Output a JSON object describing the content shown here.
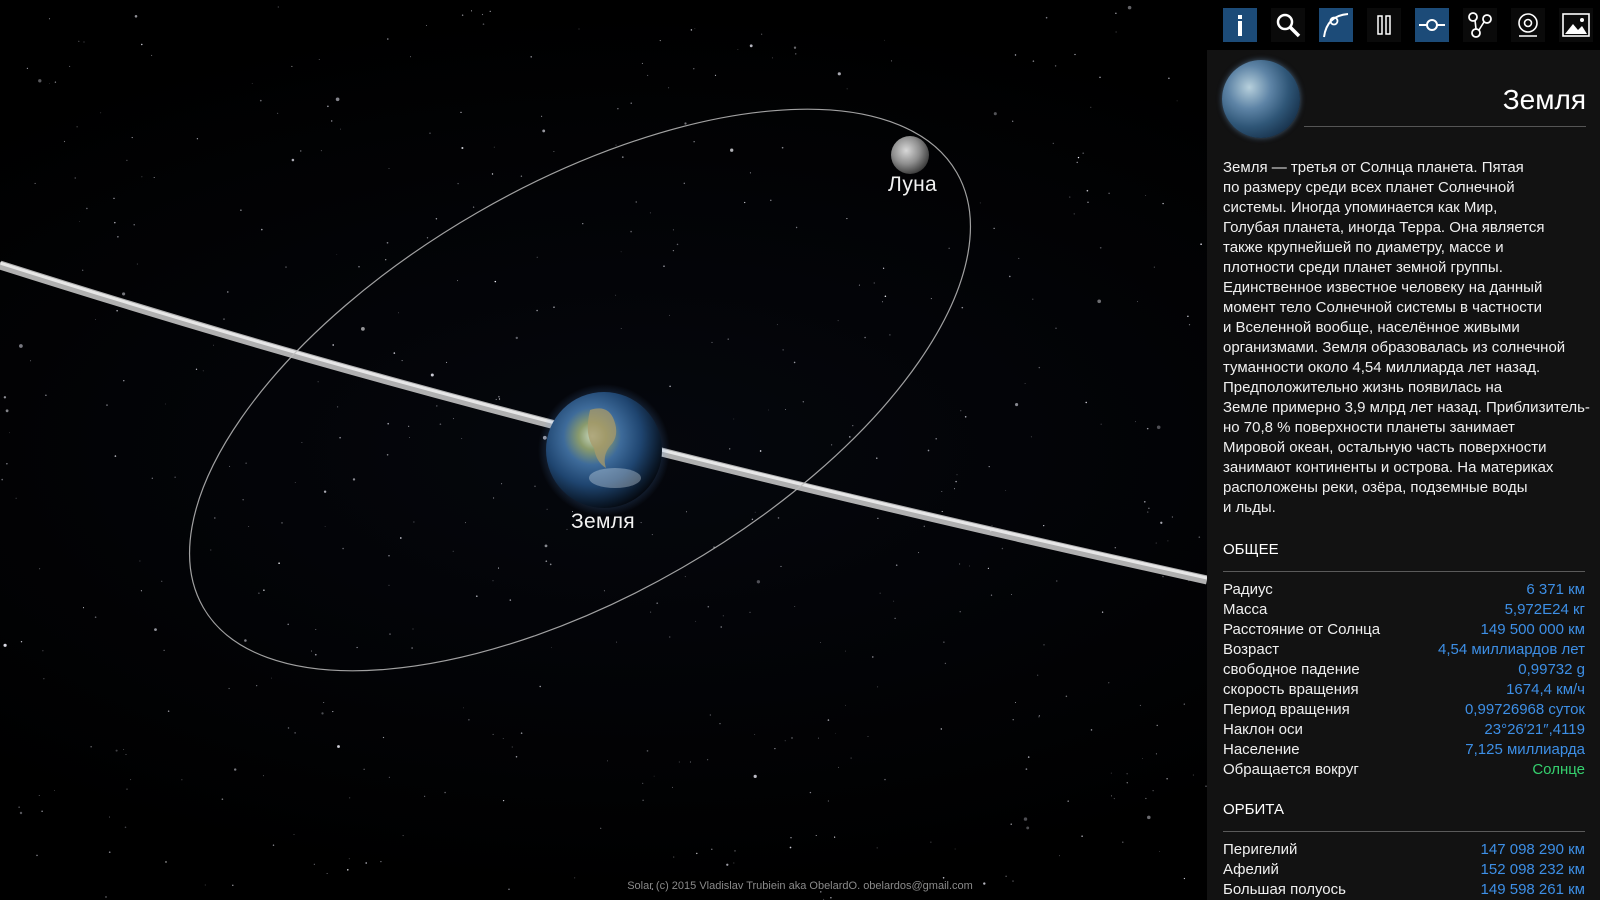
{
  "scene": {
    "labels": {
      "earth": "Земля",
      "moon": "Луна"
    },
    "credit": "Solar (c) 2015 Vladislav Trubiein aka ObelardO. obelardos@gmail.com"
  },
  "toolbar": {
    "tools": [
      {
        "icon": "info-icon",
        "active": true
      },
      {
        "icon": "search-icon",
        "active": false
      },
      {
        "icon": "orbit-curve-icon",
        "active": true
      },
      {
        "icon": "pause-icon",
        "active": false
      },
      {
        "icon": "link-node-icon",
        "active": true
      },
      {
        "icon": "share-nodes-icon",
        "active": false
      },
      {
        "icon": "at-icon",
        "active": false
      },
      {
        "icon": "image-icon",
        "active": false
      }
    ]
  },
  "panel": {
    "planet_name": "Земля",
    "description_lines": [
      "Земля — третья от Солнца планета. Пятая",
      "по размеру среди всех планет Солнечной",
      "системы. Иногда упоминается как Мир,",
      "Голубая планета, иногда Терра. Она является",
      "также крупнейшей по диаметру, массе и",
      "плотности среди планет земной группы.",
      "Единственное известное человеку на данный",
      "момент тело Солнечной системы в частности",
      "и Вселенной вообще, населённое живыми",
      "организмами. Земля образовалась из солнечной",
      "туманности около 4,54 миллиарда лет назад.",
      "Предположительно жизнь появилась на",
      "Земле примерно 3,9 млрд лет назад. Приблизитель-",
      "но 70,8 % поверхности планеты занимает",
      "Мировой океан, остальную часть поверхности",
      "занимают континенты и острова. На материках",
      "расположены реки, озёра, подземные воды",
      "и льды."
    ],
    "general": {
      "title": "ОБЩЕЕ",
      "rows": [
        {
          "label": "Радиус",
          "value": "6 371 км"
        },
        {
          "label": "Масса",
          "value": "5,972E24 кг"
        },
        {
          "label": "Расстояние от Солнца",
          "value": "149 500 000 км"
        },
        {
          "label": "Возраст",
          "value": "4,54 миллиардов лет"
        },
        {
          "label": "свободное падение",
          "value": "0,99732 g"
        },
        {
          "label": "скорость вращения",
          "value": "1674,4 км/ч"
        },
        {
          "label": "Период вращения",
          "value": "0,99726968 суток"
        },
        {
          "label": "Наклон оси",
          "value": "23°26′21″,4119"
        },
        {
          "label": "Население",
          "value": "7,125 миллиарда"
        },
        {
          "label": "Обращается вокруг",
          "value": "Солнце",
          "color": "#35d06e"
        }
      ]
    },
    "orbit": {
      "title": "ОРБИТА",
      "rows": [
        {
          "label": "Перигелий",
          "value": "147 098 290 км"
        },
        {
          "label": "Афелий",
          "value": "152 098 232 км"
        },
        {
          "label": "Большая полуось",
          "value": "149 598 261 км"
        }
      ]
    }
  }
}
